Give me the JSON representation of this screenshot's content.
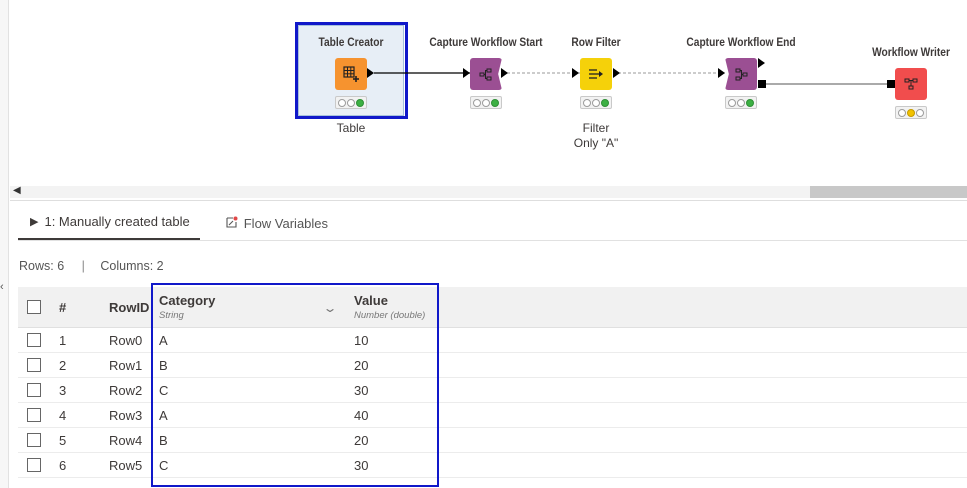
{
  "workflow": {
    "nodes": [
      {
        "title": "Table Creator",
        "caption": "Table",
        "color": "#f6932f",
        "icon": "table-plus-icon",
        "status": [
          "off",
          "off",
          "green"
        ]
      },
      {
        "title": "Capture Workflow Start",
        "caption": "",
        "color": "#9b4f93",
        "icon": "capture-start-icon",
        "status": [
          "off",
          "off",
          "green"
        ]
      },
      {
        "title": "Row Filter",
        "caption": "Filter\nOnly \"A\"",
        "color": "#f5d10a",
        "icon": "row-filter-icon",
        "status": [
          "off",
          "off",
          "green"
        ]
      },
      {
        "title": "Capture Workflow End",
        "caption": "",
        "color": "#9b4f93",
        "icon": "capture-end-icon",
        "status": [
          "off",
          "off",
          "green"
        ]
      },
      {
        "title": "Workflow Writer",
        "caption": "",
        "color": "#f14d4d",
        "icon": "workflow-writer-icon",
        "status": [
          "off",
          "yellow",
          "off"
        ]
      }
    ]
  },
  "tabs": [
    {
      "label": "1: Manually created table",
      "icon": "play-icon",
      "active": true
    },
    {
      "label": "Flow Variables",
      "icon": "flow-variable-icon",
      "active": false
    }
  ],
  "table_meta": {
    "rows": "Rows: 6",
    "separator": "|",
    "columns": "Columns: 2"
  },
  "table": {
    "headers": {
      "num": "#",
      "rowid": "RowID",
      "category": {
        "title": "Category",
        "type": "String"
      },
      "value": {
        "title": "Value",
        "type": "Number (double)"
      }
    },
    "rows": [
      {
        "num": "1",
        "rowid": "Row0",
        "category": "A",
        "value": "10"
      },
      {
        "num": "2",
        "rowid": "Row1",
        "category": "B",
        "value": "20"
      },
      {
        "num": "3",
        "rowid": "Row2",
        "category": "C",
        "value": "30"
      },
      {
        "num": "4",
        "rowid": "Row3",
        "category": "A",
        "value": "40"
      },
      {
        "num": "5",
        "rowid": "Row4",
        "category": "B",
        "value": "20"
      },
      {
        "num": "6",
        "rowid": "Row5",
        "category": "C",
        "value": "30"
      }
    ]
  },
  "colors": {
    "highlight": "#1018c9",
    "selection_bg": "#e7eef6"
  }
}
